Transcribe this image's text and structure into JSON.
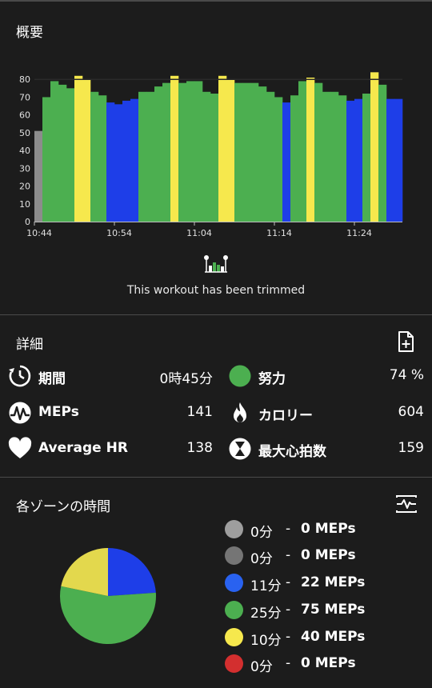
{
  "overview": {
    "title": "概要",
    "trim_message": "This workout has been trimmed"
  },
  "chart_data": {
    "type": "bar",
    "y_ticks": [
      "0",
      "10",
      "20",
      "30",
      "40",
      "50",
      "60",
      "70",
      "80"
    ],
    "ylim": [
      0,
      90
    ],
    "x_tick_labels": [
      "10:44",
      "10:54",
      "11:04",
      "11:14",
      "11:24"
    ],
    "values": [
      51,
      70,
      79,
      77,
      75,
      82,
      80,
      73,
      71,
      67,
      66,
      68,
      69,
      73,
      73,
      76,
      78,
      82,
      78,
      79,
      79,
      73,
      72,
      82,
      80,
      78,
      78,
      78,
      76,
      73,
      70,
      67,
      71,
      79,
      81,
      78,
      73,
      73,
      71,
      68,
      69,
      72,
      84,
      77,
      69,
      69
    ],
    "zones": [
      "gray",
      "green",
      "green",
      "green",
      "green",
      "yellow",
      "yellow",
      "green",
      "green",
      "blue",
      "blue",
      "blue",
      "blue",
      "green",
      "green",
      "green",
      "green",
      "yellow",
      "green",
      "green",
      "green",
      "green",
      "green",
      "yellow",
      "yellow",
      "green",
      "green",
      "green",
      "green",
      "green",
      "green",
      "blue",
      "green",
      "green",
      "yellow",
      "green",
      "green",
      "green",
      "green",
      "blue",
      "blue",
      "green",
      "yellow",
      "green",
      "blue",
      "blue"
    ],
    "reference_line": 80,
    "zone_colors": {
      "gray": "#8c8c8c",
      "green": "#4caf50",
      "yellow": "#f6e84d",
      "blue": "#1e3ee8"
    }
  },
  "details": {
    "title": "詳細",
    "add_icon": "add-document-icon",
    "stats": [
      {
        "icon": "timer-icon",
        "label": "期間",
        "value": "0時45分"
      },
      {
        "icon": "effort-icon",
        "label": "努力",
        "value": "74 %",
        "color": "#4caf50"
      },
      {
        "icon": "meps-icon",
        "label": "MEPs",
        "value": "141"
      },
      {
        "icon": "flame-icon",
        "label": "カロリー",
        "value": "604"
      },
      {
        "icon": "heart-icon",
        "label": "Average HR",
        "value": "138"
      },
      {
        "icon": "hourglass-icon",
        "label": "最大心拍数",
        "value": "159"
      }
    ]
  },
  "zones": {
    "title": "各ゾーンの時間",
    "chart_toggle_icon": "chart-toggle-icon",
    "legend": [
      {
        "time": "0分",
        "meps": "0 MEPs",
        "color": "#9e9e9e"
      },
      {
        "time": "0分",
        "meps": "0 MEPs",
        "color": "#757575"
      },
      {
        "time": "11分",
        "meps": "22 MEPs",
        "color": "#2962f0"
      },
      {
        "time": "25分",
        "meps": "75 MEPs",
        "color": "#4caf50"
      },
      {
        "time": "10分",
        "meps": "40 MEPs",
        "color": "#f6e84d"
      },
      {
        "time": "0分",
        "meps": "0 MEPs",
        "color": "#d32f2f"
      }
    ],
    "pie": {
      "minutes": [
        11,
        25,
        10
      ],
      "colors": [
        "#1e3ee8",
        "#4caf50",
        "#e3d84d"
      ],
      "names": [
        "blue-zone",
        "green-zone",
        "yellow-zone"
      ]
    }
  }
}
